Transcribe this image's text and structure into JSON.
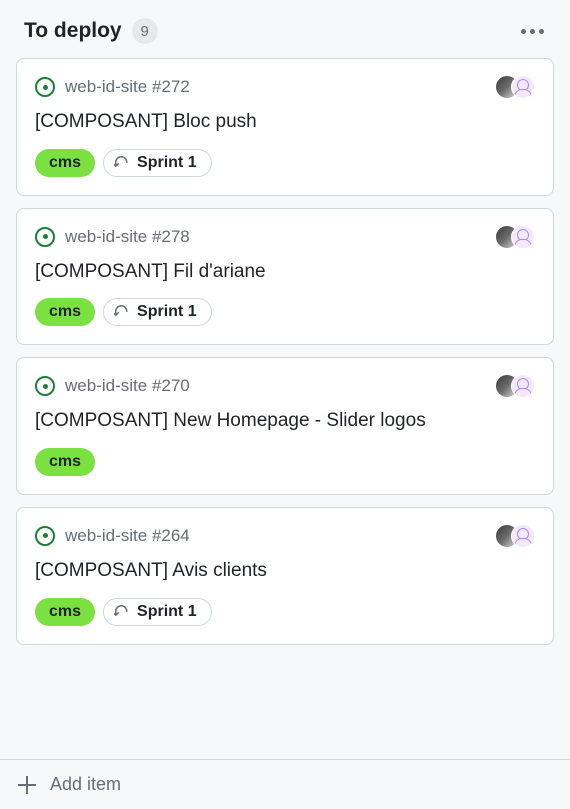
{
  "column": {
    "title": "To deploy",
    "count": "9",
    "add_item_label": "Add item"
  },
  "cards": [
    {
      "repo": "web-id-site",
      "number": "#272",
      "title": "[COMPOSANT] Bloc push",
      "labels": {
        "cms": "cms",
        "sprint": "Sprint 1"
      },
      "has_sprint": true
    },
    {
      "repo": "web-id-site",
      "number": "#278",
      "title": "[COMPOSANT] Fil d'ariane",
      "labels": {
        "cms": "cms",
        "sprint": "Sprint 1"
      },
      "has_sprint": true
    },
    {
      "repo": "web-id-site",
      "number": "#270",
      "title": "[COMPOSANT] New Homepage - Slider logos",
      "labels": {
        "cms": "cms"
      },
      "has_sprint": false
    },
    {
      "repo": "web-id-site",
      "number": "#264",
      "title": "[COMPOSANT] Avis clients",
      "labels": {
        "cms": "cms",
        "sprint": "Sprint 1"
      },
      "has_sprint": true
    }
  ]
}
